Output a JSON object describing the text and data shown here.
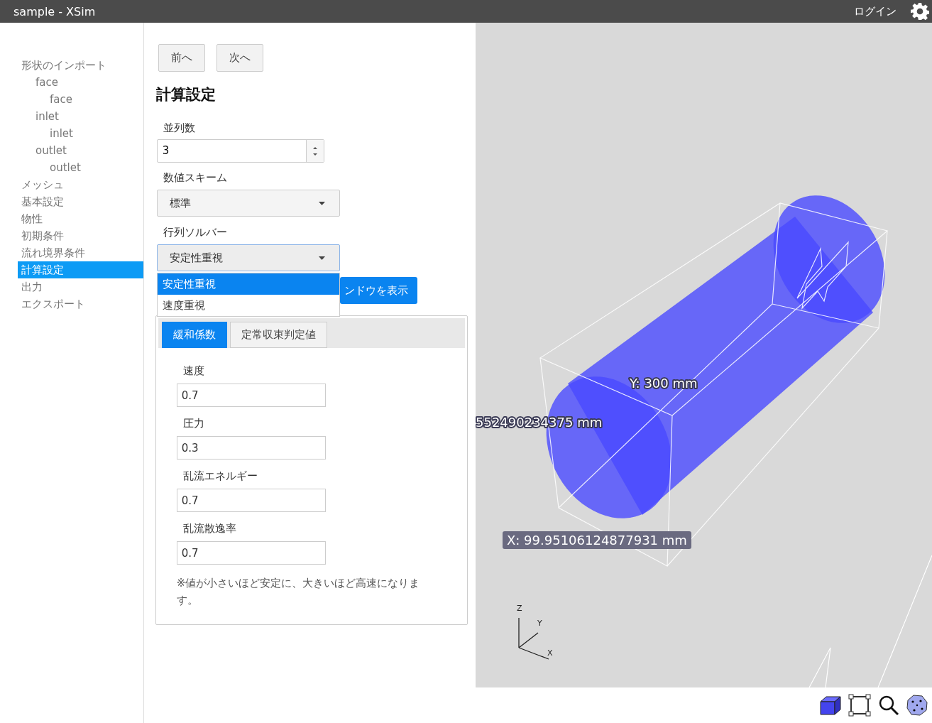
{
  "window": {
    "title": "sample - XSim"
  },
  "header": {
    "login": "ログイン"
  },
  "sidebar": {
    "items": [
      {
        "label": "形状のインポート",
        "selected": false,
        "children": [
          {
            "label": "face",
            "selected": false,
            "children": [
              {
                "label": "face",
                "selected": false
              }
            ]
          },
          {
            "label": "inlet",
            "selected": false,
            "children": [
              {
                "label": "inlet",
                "selected": false
              }
            ]
          },
          {
            "label": "outlet",
            "selected": false,
            "children": [
              {
                "label": "outlet",
                "selected": false
              }
            ]
          }
        ]
      },
      {
        "label": "メッシュ",
        "selected": false
      },
      {
        "label": "基本設定",
        "selected": false
      },
      {
        "label": "物性",
        "selected": false
      },
      {
        "label": "初期条件",
        "selected": false
      },
      {
        "label": "流れ境界条件",
        "selected": false
      },
      {
        "label": "計算設定",
        "selected": true
      },
      {
        "label": "出力",
        "selected": false
      },
      {
        "label": "エクスポート",
        "selected": false
      }
    ]
  },
  "nav_buttons": [
    "前へ",
    "次へ"
  ],
  "heading": "計算設定",
  "fields": [
    {
      "kind": "number",
      "label": "並列数",
      "value": "3"
    },
    {
      "kind": "select",
      "label": "数値スキーム",
      "value": "標準",
      "open": false
    },
    {
      "kind": "select",
      "label": "行列ソルバー",
      "value": "安定性重視",
      "open": true,
      "options": [
        {
          "label": "安定性重視",
          "selected": true
        },
        {
          "label": "速度重視",
          "selected": false
        }
      ]
    }
  ],
  "window_button": "ンドウを表示",
  "tabs": [
    {
      "label": "緩和係数",
      "selected": true
    },
    {
      "label": "定常収束判定値",
      "selected": false
    }
  ],
  "tab_fields": [
    {
      "label": "速度",
      "value": "0.7"
    },
    {
      "label": "圧力",
      "value": "0.3"
    },
    {
      "label": "乱流エネルギー",
      "value": "0.7"
    },
    {
      "label": "乱流散逸率",
      "value": "0.7"
    }
  ],
  "note": "※値が小さいほど安定に、大きいほど高速になります。",
  "viewport": {
    "dimension_labels": [
      "Y: 300 mm",
      "552490234375 mm",
      "X: 99.95106124877931 mm"
    ],
    "axis_labels": [
      "Z",
      "Y",
      "X"
    ]
  }
}
